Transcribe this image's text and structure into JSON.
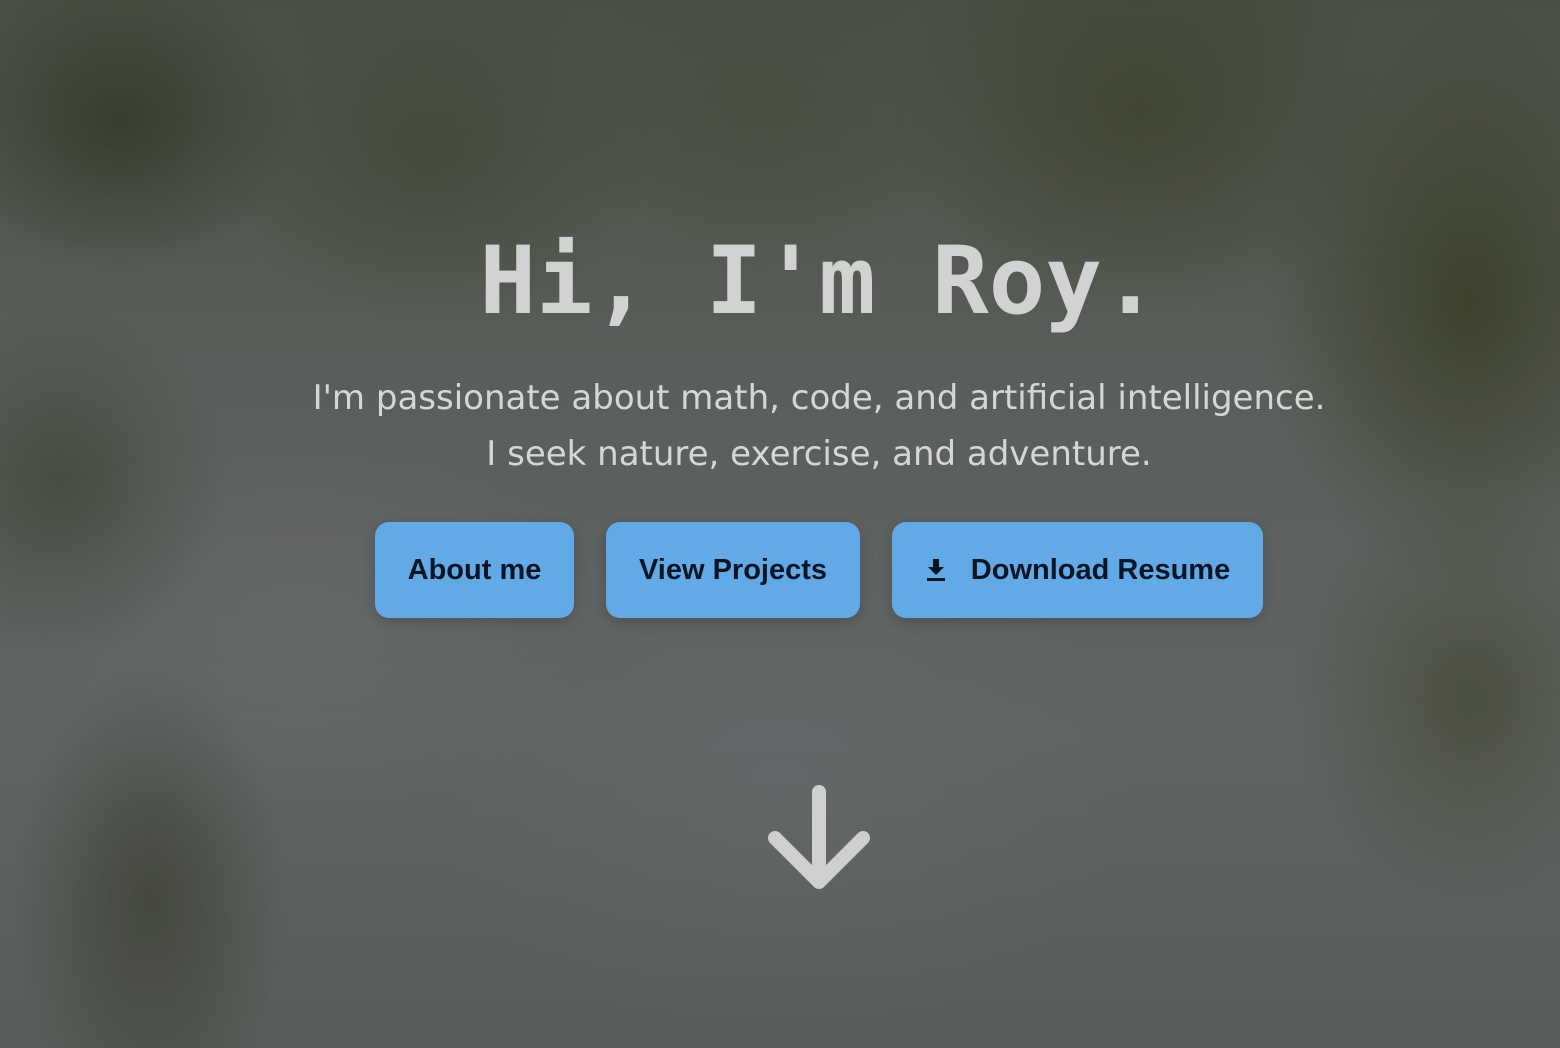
{
  "hero": {
    "title": "Hi, I'm Roy.",
    "tagline_line1": "I'm passionate about math, code, and artificial intelligence.",
    "tagline_line2": "I seek nature, exercise, and adventure.",
    "buttons": {
      "about_label": "About me",
      "projects_label": "View Projects",
      "resume_label": "Download Resume",
      "resume_icon": "download-icon"
    },
    "scroll_icon": "arrow-down-icon"
  },
  "colors": {
    "button_bg": "#62aae7",
    "button_text": "#0a1522",
    "title_text": "#d2d2d2"
  }
}
